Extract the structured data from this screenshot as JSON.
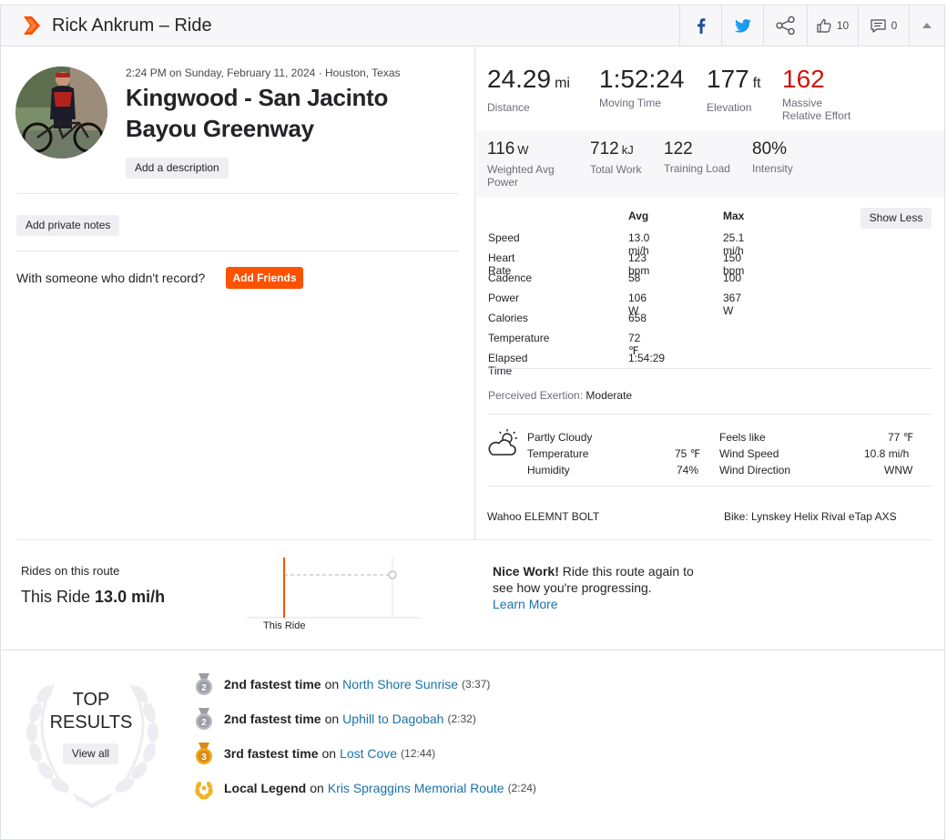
{
  "header": {
    "title": "Rick Ankrum – Ride",
    "kudos_count": "10",
    "comments_count": "0"
  },
  "activity": {
    "meta": "2:24 PM on Sunday, February 11, 2024 · Houston, Texas",
    "title": "Kingwood - San Jacinto Bayou Greenway",
    "add_description": "Add a description",
    "add_private_notes": "Add private notes",
    "with_someone": "With someone who didn't record?",
    "add_friends": "Add Friends"
  },
  "primary_stats": [
    {
      "value": "24.29",
      "unit": "mi",
      "label": "Distance"
    },
    {
      "value": "1:52:24",
      "unit": "",
      "label": "Moving Time"
    },
    {
      "value": "177",
      "unit": "ft",
      "label": "Elevation"
    },
    {
      "value": "162",
      "unit": "",
      "label": "Massive\nRelative Effort"
    }
  ],
  "secondary_stats": [
    {
      "value": "116",
      "unit": "W",
      "label": "Weighted Avg\nPower"
    },
    {
      "value": "712",
      "unit": "kJ",
      "label": "Total Work"
    },
    {
      "value": "122",
      "unit": "",
      "label": "Training Load"
    },
    {
      "value": "80%",
      "unit": "",
      "label": "Intensity"
    }
  ],
  "more_stats": {
    "show_less": "Show Less",
    "headers": [
      "",
      "Avg",
      "Max"
    ],
    "rows": [
      [
        "Speed",
        "13.0 mi/h",
        "25.1 mi/h"
      ],
      [
        "Heart Rate",
        "123 bpm",
        "150 bpm"
      ],
      [
        "Cadence",
        "58",
        "100"
      ],
      [
        "Power",
        "106 W",
        "367 W"
      ],
      [
        "Calories",
        "658",
        ""
      ],
      [
        "Temperature",
        "72 ℉",
        ""
      ],
      [
        "Elapsed Time",
        "1:54:29",
        ""
      ]
    ]
  },
  "exertion": {
    "label": "Perceived Exertion:",
    "value": "Moderate"
  },
  "weather": {
    "condition": "Partly Cloudy",
    "temperature_label": "Temperature",
    "temperature": "75 ℉",
    "humidity_label": "Humidity",
    "humidity": "74%",
    "feels_like_label": "Feels like",
    "feels_like": "77 ℉",
    "wind_speed_label": "Wind Speed",
    "wind_speed": "10.8 mi/h",
    "wind_direction_label": "Wind Direction",
    "wind_direction": "WNW"
  },
  "device": "Wahoo ELEMNT BOLT",
  "bike": "Bike: Lynskey Helix Rival eTap AXS",
  "route": {
    "label": "Rides on this route",
    "this_ride_label": "This Ride",
    "this_ride_value": "13.0 mi/h",
    "chart_label": "This Ride",
    "nice_work": "Nice Work!",
    "nice_text": " Ride this route again to see how you're progressing.",
    "learn_more": "Learn More"
  },
  "top_results": {
    "title_line1": "TOP",
    "title_line2": "RESULTS",
    "view_all": "View all",
    "items": [
      {
        "rank": "2nd fastest time",
        "on": "on",
        "segment": "North Shore Sunrise",
        "time": "(3:37)",
        "medal": "silver",
        "num": "2"
      },
      {
        "rank": "2nd fastest time",
        "on": "on",
        "segment": "Uphill to Dagobah",
        "time": "(2:32)",
        "medal": "silver",
        "num": "2"
      },
      {
        "rank": "3rd fastest time",
        "on": "on",
        "segment": "Lost Cove",
        "time": "(12:44)",
        "medal": "bronze",
        "num": "3"
      },
      {
        "rank": "Local Legend",
        "on": "on",
        "segment": "Kris Spraggins Memorial Route",
        "time": "(2:24)",
        "medal": "legend",
        "num": ""
      }
    ]
  },
  "colors": {
    "brand": "#fc5200",
    "link": "#1a73a8",
    "effort_red": "#d1160f"
  }
}
